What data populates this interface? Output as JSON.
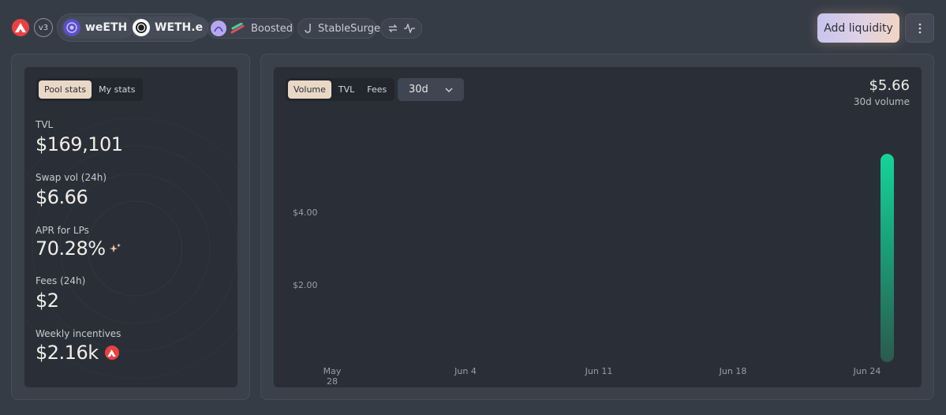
{
  "header": {
    "network_icon": "avalanche-icon",
    "version_label": "v3",
    "tokens": [
      {
        "symbol": "weETH",
        "icon": "weeth-token-icon"
      },
      {
        "symbol": "WETH.e",
        "icon": "weth-token-icon"
      }
    ],
    "boosted_label": "Boosted",
    "stablesurge_label": "StableSurge",
    "add_liquidity_label": "Add liquidity"
  },
  "stats": {
    "tabs": [
      "Pool stats",
      "My stats"
    ],
    "active_tab": "Pool stats",
    "tvl_label": "TVL",
    "tvl_value": "$169,101",
    "swap_label": "Swap vol (24h)",
    "swap_value": "$6.66",
    "apr_label": "APR for LPs",
    "apr_value": "70.28%",
    "fees_label": "Fees (24h)",
    "fees_value": "$2",
    "incentives_label": "Weekly incentives",
    "incentives_value": "$2.16k"
  },
  "chart_panel": {
    "tabs": [
      "Volume",
      "TVL",
      "Fees"
    ],
    "active_tab": "Volume",
    "period": "30d",
    "headline_value": "$5.66",
    "headline_caption": "30d volume"
  },
  "chart_data": {
    "type": "bar",
    "categories": [
      "May 28",
      "Jun 4",
      "Jun 11",
      "Jun 18",
      "Jun 24"
    ],
    "y_ticks": [
      "$4.00",
      "$2.00"
    ],
    "series": [
      {
        "x": "Jun 24",
        "value": 5.66
      }
    ],
    "ylim": [
      0,
      6
    ],
    "grid": false,
    "accent_top": "#16d39a",
    "accent_bottom": "#2b5a4e"
  }
}
